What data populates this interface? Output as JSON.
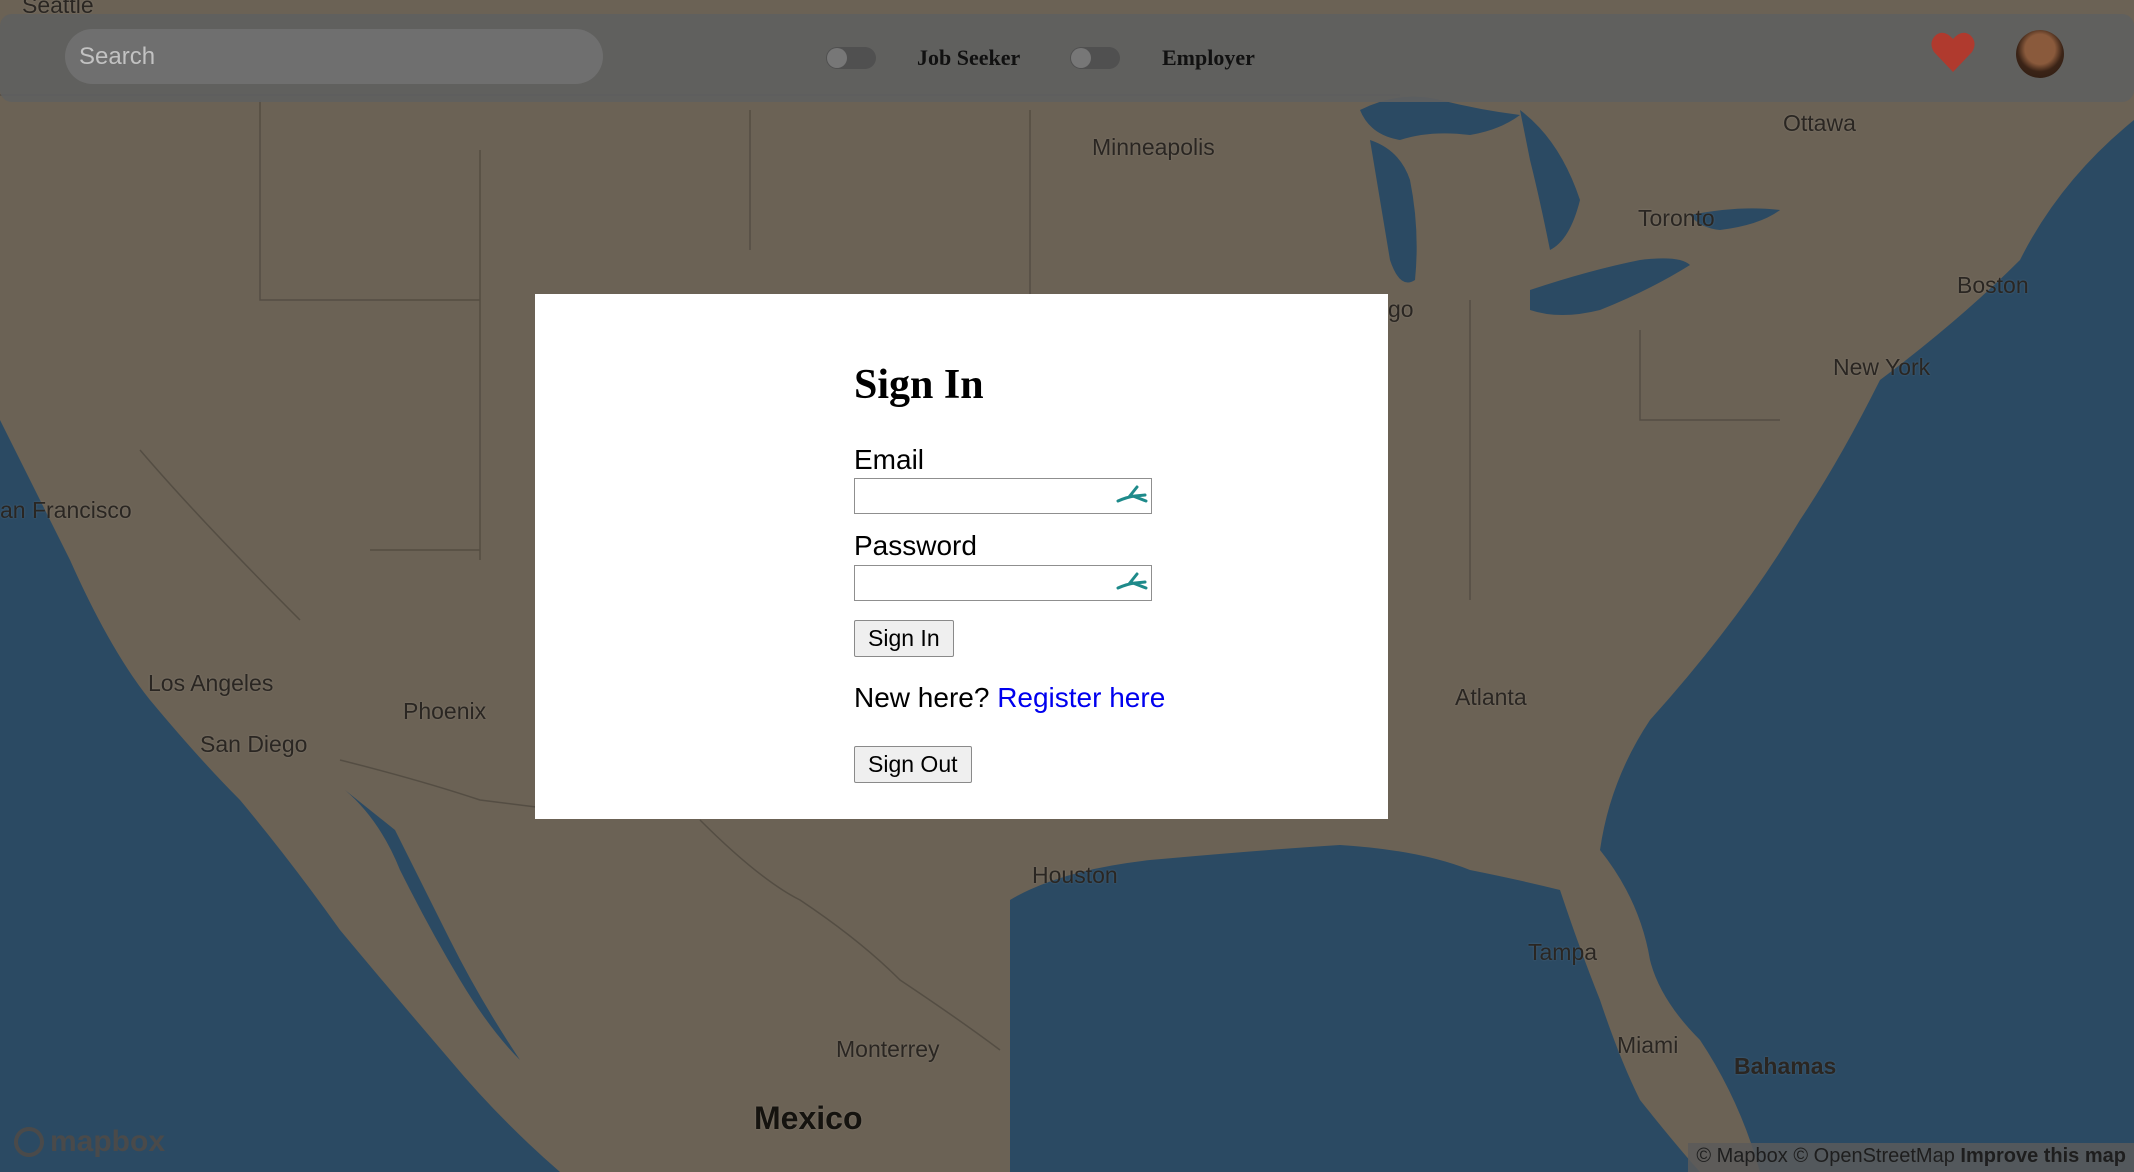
{
  "search": {
    "placeholder": "Search"
  },
  "toggles": {
    "job_seeker": "Job Seeker",
    "employer": "Employer"
  },
  "map": {
    "cities": {
      "seattle": "Seattle",
      "minneapolis": "Minneapolis",
      "ottawa": "Ottawa",
      "toronto": "Toronto",
      "boston": "Boston",
      "new_york": "New York",
      "chicago_partial": "go",
      "san_francisco": "an Francisco",
      "los_angeles": "Los Angeles",
      "phoenix": "Phoenix",
      "san_diego": "San Diego",
      "atlanta": "Atlanta",
      "houston": "Houston",
      "tampa": "Tampa",
      "monterrey": "Monterrey",
      "miami": "Miami",
      "bahamas": "Bahamas",
      "mexico": "Mexico"
    },
    "logo": "mapbox",
    "attribution": {
      "mapbox": "© Mapbox",
      "osm": "© OpenStreetMap",
      "improve": "Improve this map"
    }
  },
  "signin": {
    "title": "Sign In",
    "email_label": "Email",
    "email_value": "",
    "password_label": "Password",
    "password_value": "",
    "signin_button": "Sign In",
    "new_here": "New here?",
    "register_link": "Register here",
    "signout_button": "Sign Out"
  },
  "colors": {
    "heart": "#c0392b",
    "link": "#0000ee",
    "water": "#2b4a63",
    "land": "#6b6255"
  }
}
